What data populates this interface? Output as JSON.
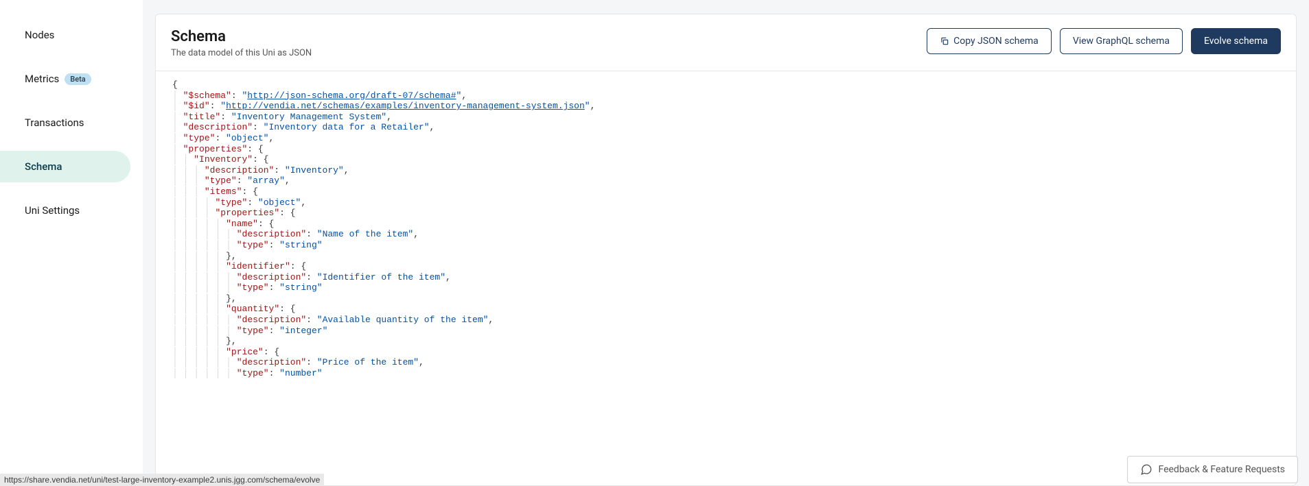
{
  "sidebar": {
    "items": [
      {
        "label": "Nodes",
        "badge": null,
        "active": false
      },
      {
        "label": "Metrics",
        "badge": "Beta",
        "active": false
      },
      {
        "label": "Transactions",
        "badge": null,
        "active": false
      },
      {
        "label": "Schema",
        "badge": null,
        "active": true
      },
      {
        "label": "Uni Settings",
        "badge": null,
        "active": false
      }
    ]
  },
  "header": {
    "title": "Schema",
    "subtitle": "The data model of this Uni as JSON",
    "actions": {
      "copy": "Copy JSON schema",
      "graphql": "View GraphQL schema",
      "evolve": "Evolve schema"
    }
  },
  "schema_json": {
    "$schema": "http://json-schema.org/draft-07/schema#",
    "$id": "http://vendia.net/schemas/examples/inventory-management-system.json",
    "title": "Inventory Management System",
    "description": "Inventory data for a Retailer",
    "type": "object",
    "properties": {
      "Inventory": {
        "description": "Inventory",
        "type": "array",
        "items": {
          "type": "object",
          "properties": {
            "name": {
              "description": "Name of the item",
              "type": "string"
            },
            "identifier": {
              "description": "Identifier of the item",
              "type": "string"
            },
            "quantity": {
              "description": "Available quantity of the item",
              "type": "integer"
            },
            "price": {
              "description": "Price of the item",
              "type": "number"
            }
          }
        }
      }
    }
  },
  "feedback": {
    "label": "Feedback & Feature Requests"
  },
  "status_url": "https://share.vendia.net/uni/test-large-inventory-example2.unis.jgg.com/schema/evolve"
}
